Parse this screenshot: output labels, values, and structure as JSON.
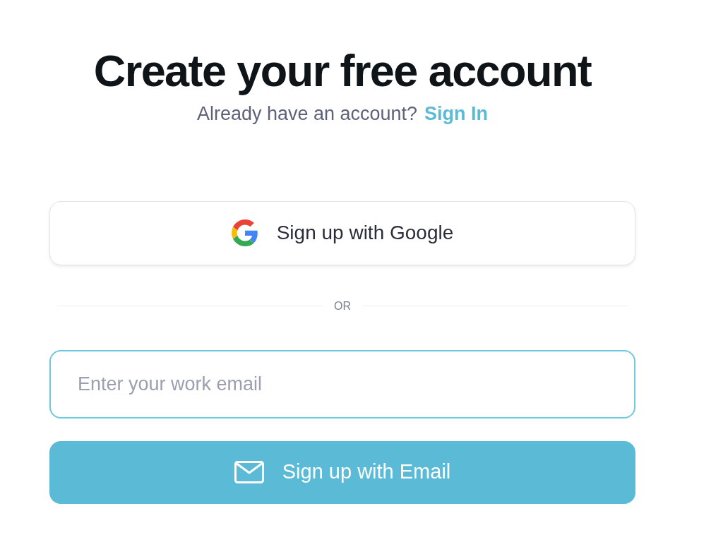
{
  "heading": "Create your free account",
  "subtitle": {
    "text": "Already have an account?",
    "link": "Sign In"
  },
  "google_button": {
    "label": "Sign up with Google"
  },
  "divider": "OR",
  "email_field": {
    "placeholder": "Enter your work email",
    "focused": true
  },
  "email_button": {
    "label": "Sign up with Email"
  }
}
